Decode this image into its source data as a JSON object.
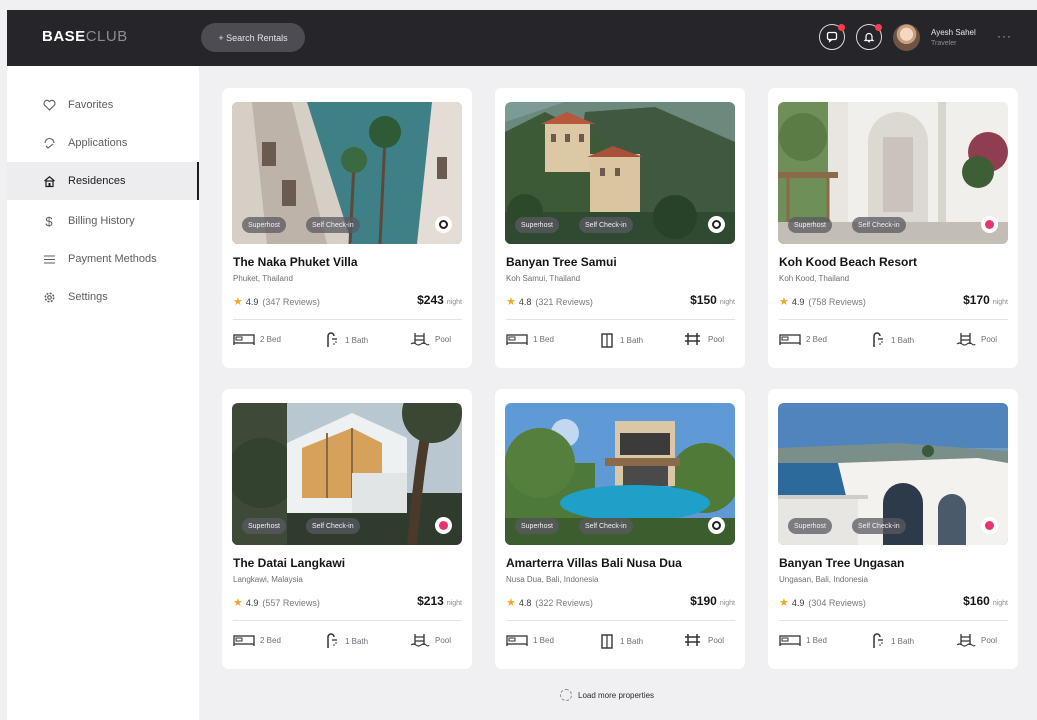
{
  "header": {
    "logo_bold": "BASE",
    "logo_light": "CLUB",
    "search_label": "+ Search Rentals",
    "user_name": "Ayesh Sahel",
    "user_role": "Traveler",
    "more": "···"
  },
  "sidebar": {
    "items": [
      {
        "label": "Favorites",
        "icon": "heart-icon"
      },
      {
        "label": "Applications",
        "icon": "applications-icon"
      },
      {
        "label": "Residences",
        "icon": "residences-icon",
        "active": true
      },
      {
        "label": "Billing History",
        "icon": "dollar-icon"
      },
      {
        "label": "Payment Methods",
        "icon": "menu-icon"
      },
      {
        "label": "Settings",
        "icon": "gear-icon"
      }
    ]
  },
  "cards": [
    {
      "title": "The Naka Phuket Villa",
      "location": "Phuket, Thailand",
      "rating": "4.9",
      "reviews": "(347 Reviews)",
      "price": "$243",
      "unit": "night",
      "badge1": "Superhost",
      "badge2": "Self Check-in",
      "favorited": false,
      "amenities": [
        "2 Bed",
        "1 Bath",
        "Pool"
      ]
    },
    {
      "title": "Banyan Tree Samui",
      "location": "Koh Samui, Thailand",
      "rating": "4.8",
      "reviews": "(321 Reviews)",
      "price": "$150",
      "unit": "night",
      "badge1": "Superhost",
      "badge2": "Self Check-in",
      "favorited": false,
      "amenities": [
        "1 Bed",
        "1 Bath",
        "Pool"
      ]
    },
    {
      "title": "Koh Kood Beach Resort",
      "location": "Koh Kood, Thailand",
      "rating": "4.9",
      "reviews": "(758 Reviews)",
      "price": "$170",
      "unit": "night",
      "badge1": "Superhost",
      "badge2": "Self Check-in",
      "favorited": true,
      "amenities": [
        "2 Bed",
        "1 Bath",
        "Pool"
      ]
    },
    {
      "title": "The Datai Langkawi",
      "location": "Langkawi, Malaysia",
      "rating": "4.9",
      "reviews": "(557 Reviews)",
      "price": "$213",
      "unit": "night",
      "badge1": "Superhost",
      "badge2": "Self Check-in",
      "favorited": true,
      "amenities": [
        "2 Bed",
        "1 Bath",
        "Pool"
      ]
    },
    {
      "title": "Amarterra Villas Bali Nusa Dua",
      "location": "Nusa Dua, Bali, Indonesia",
      "rating": "4.8",
      "reviews": "(322 Reviews)",
      "price": "$190",
      "unit": "night",
      "badge1": "Superhost",
      "badge2": "Self Check-in",
      "favorited": false,
      "amenities": [
        "1 Bed",
        "1 Bath",
        "Pool"
      ]
    },
    {
      "title": "Banyan Tree Ungasan",
      "location": "Ungasan, Bali, Indonesia",
      "rating": "4.9",
      "reviews": "(304 Reviews)",
      "price": "$160",
      "unit": "night",
      "badge1": "Superhost",
      "badge2": "Self Check-in",
      "favorited": true,
      "amenities": [
        "1 Bed",
        "1 Bath",
        "Pool"
      ]
    }
  ],
  "load_more": "Load more properties",
  "colors": {
    "accent": "#e8336e",
    "topbar": "#26262a",
    "star": "#f5a623",
    "notification": "#ff3b4e"
  }
}
